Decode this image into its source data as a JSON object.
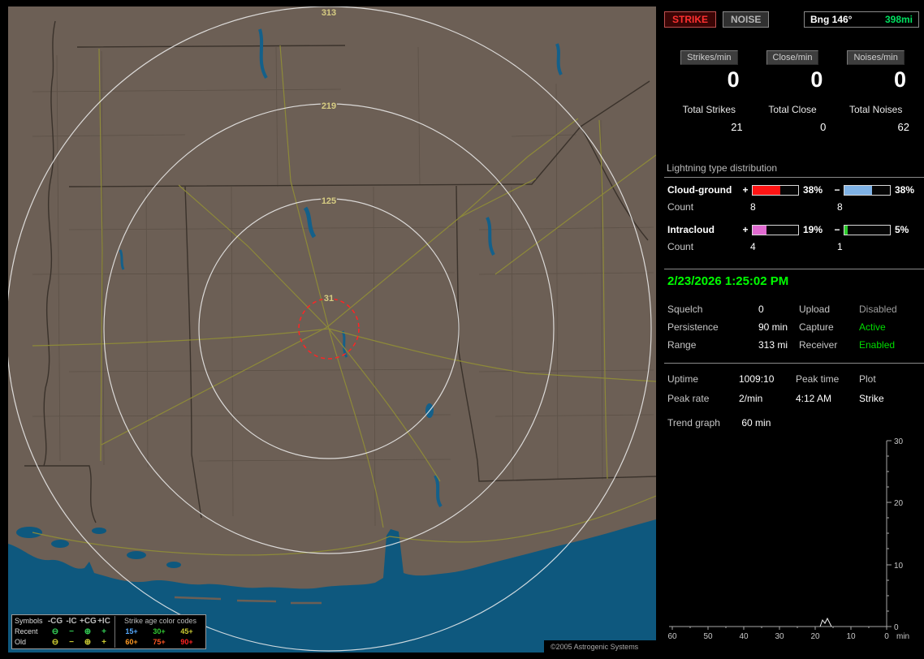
{
  "map": {
    "ring_labels": [
      "313",
      "219",
      "125",
      "31"
    ],
    "copyright": "©2005 Astrogenic Systems",
    "legend": {
      "symbols_header": "Symbols",
      "col_headers": [
        "-CG",
        "-IC",
        "+CG",
        "+IC"
      ],
      "age_header": "Strike age color codes",
      "symbols": [
        "⊖",
        "−",
        "⊕",
        "+"
      ],
      "rows": [
        {
          "label": "Recent",
          "symbol_color": "#33cc55",
          "ages": [
            {
              "text": "15+",
              "color": "#55aaff"
            },
            {
              "text": "30+",
              "color": "#33cc33"
            },
            {
              "text": "45+",
              "color": "#cccc33"
            }
          ]
        },
        {
          "label": "Old",
          "symbol_color": "#cccc33",
          "ages": [
            {
              "text": "60+",
              "color": "#ff9922"
            },
            {
              "text": "75+",
              "color": "#ff5522"
            },
            {
              "text": "90+",
              "color": "#ff2222"
            }
          ]
        }
      ]
    }
  },
  "panel": {
    "strike_button": "STRIKE",
    "noise_button": "NOISE",
    "bearing": {
      "label": "Bng 146°",
      "value": "398mi",
      "value_color": "#00e060"
    },
    "rate_boxes": [
      {
        "label": "Strikes/min",
        "value": "0"
      },
      {
        "label": "Close/min",
        "value": "0"
      },
      {
        "label": "Noises/min",
        "value": "0"
      }
    ],
    "totals": [
      {
        "label": "Total Strikes",
        "value": "21"
      },
      {
        "label": "Total Close",
        "value": "0"
      },
      {
        "label": "Total Noises",
        "value": "62"
      }
    ],
    "distribution": {
      "title": "Lightning type distribution",
      "count_label": "Count",
      "plus": "+",
      "minus": "−",
      "rows": [
        {
          "label": "Cloud-ground",
          "pos_pct": "38%",
          "neg_pct": "38%",
          "pos_count": "8",
          "neg_count": "8",
          "pos_color": "#ff1414",
          "neg_color": "#7fb2e5"
        },
        {
          "label": "Intracloud",
          "pos_pct": "19%",
          "neg_pct": "5%",
          "pos_count": "4",
          "neg_count": "1",
          "pos_color": "#e06ad0",
          "neg_color": "#2ecc2e"
        }
      ]
    },
    "datetime": "2/23/2026 1:25:02 PM",
    "settings": [
      {
        "label": "Squelch",
        "value": "0",
        "label2": "Upload",
        "value2": "Disabled",
        "value2_color": "#9e9e9e"
      },
      {
        "label": "Persistence",
        "value": "90 min",
        "label2": "Capture",
        "value2": "Active",
        "value2_color": "#00dd00"
      },
      {
        "label": "Range",
        "value": "313 mi",
        "label2": "Receiver",
        "value2": "Enabled",
        "value2_color": "#00dd00"
      }
    ],
    "stats": [
      {
        "c1": "Uptime",
        "c2": "1009:10",
        "c3": "Peak time",
        "c4": "Plot"
      },
      {
        "c1": "Peak rate",
        "c2": "2/min",
        "c3": "4:12 AM",
        "c4": "Strike"
      }
    ],
    "trend": {
      "label": "Trend graph",
      "value": "60 min"
    },
    "graph": {
      "y_ticks": [
        "30",
        "20",
        "10",
        "0"
      ],
      "x_ticks": [
        "60",
        "50",
        "40",
        "30",
        "20",
        "10",
        "0"
      ],
      "x_unit": "min"
    }
  }
}
